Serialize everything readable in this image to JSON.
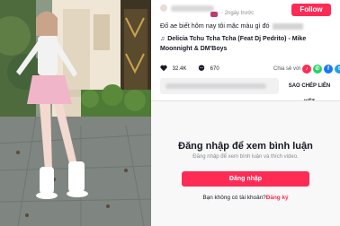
{
  "post": {
    "time": "· 2ngày trước",
    "follow_label": "Follow",
    "caption": "Đố ae biết hôm nay tôi mặc màu gì đó",
    "music_note": "♫",
    "music_title": "Delicia Tchu Tcha Tcha (Feat Dj Pedrito) - Mike Moonnight & DM'Boys"
  },
  "stats": {
    "likes": "32.4K",
    "comments": "670",
    "share_label": "Chia sẻ với"
  },
  "share_targets": [
    {
      "icon": "tiktok-share-icon",
      "glyph": "♪",
      "color": "#fe2c55"
    },
    {
      "icon": "whatsapp-icon",
      "glyph": "✆",
      "color": "#25d366"
    },
    {
      "icon": "facebook-icon",
      "glyph": "f",
      "color": "#1877f2"
    },
    {
      "icon": "twitter-icon",
      "glyph": "t",
      "color": "#1da1f2"
    },
    {
      "icon": "share-more-icon",
      "glyph": "↗",
      "color": "#4a4b50"
    }
  ],
  "link": {
    "copy_label": "SAO CHÉP LIÊN KẾT"
  },
  "login": {
    "title": "Đăng nhập để xem bình luận",
    "subtitle": "Đăng nhập để xem bình luận và thích video.",
    "button_label": "Đăng nhập",
    "no_account": "Bạn không có tài khoản?",
    "signup_label": "Đăng ký"
  },
  "colors": {
    "accent": "#fe2c55"
  }
}
